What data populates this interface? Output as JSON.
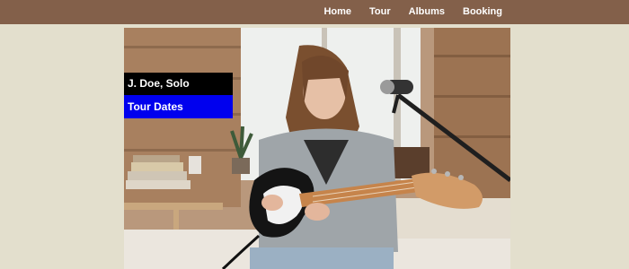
{
  "nav": {
    "items": [
      {
        "label": "Home"
      },
      {
        "label": "Tour"
      },
      {
        "label": "Albums"
      },
      {
        "label": "Booking"
      }
    ]
  },
  "hero": {
    "image_subject": "guitarist-photo",
    "caption_title": "J. Doe, Solo Guitarist",
    "caption_link": "Tour Dates"
  },
  "colors": {
    "navbar": "#83604a",
    "page_background": "#e3dfcd",
    "caption_title_bg": "#000000",
    "caption_link_bg": "#0000ee"
  }
}
